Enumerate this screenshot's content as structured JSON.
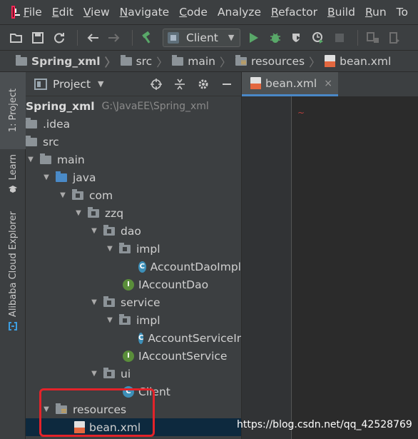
{
  "menubar": {
    "items": [
      {
        "mnemonic": "F",
        "rest": "ile"
      },
      {
        "mnemonic": "E",
        "rest": "dit"
      },
      {
        "mnemonic": "V",
        "rest": "iew"
      },
      {
        "mnemonic": "N",
        "rest": "avigate"
      },
      {
        "mnemonic": "C",
        "rest": "ode"
      },
      {
        "mnemonic": "",
        "rest": "Analyze"
      },
      {
        "mnemonic": "R",
        "rest": "efactor"
      },
      {
        "mnemonic": "B",
        "rest": "uild"
      },
      {
        "mnemonic": "R",
        "rest": "un"
      },
      {
        "mnemonic": "",
        "rest": "To"
      }
    ]
  },
  "toolbar": {
    "run_config": "Client"
  },
  "breadcrumb": {
    "items": [
      "Spring_xml",
      "src",
      "main",
      "resources",
      "bean.xml"
    ]
  },
  "side_stripe": {
    "project_tab": "1: Project",
    "learn_tab": "Learn",
    "alibaba_tab": "Alibaba Cloud Explorer"
  },
  "project_panel": {
    "title": "Project",
    "tree": [
      {
        "label": "Spring_xml",
        "hint": "G:\\JavaEE\\Spring_xml"
      },
      {
        "label": ".idea"
      },
      {
        "label": "src"
      },
      {
        "label": "main"
      },
      {
        "label": "java"
      },
      {
        "label": "com"
      },
      {
        "label": "zzq"
      },
      {
        "label": "dao"
      },
      {
        "label": "impl"
      },
      {
        "label": "AccountDaoImpl"
      },
      {
        "label": "IAccountDao"
      },
      {
        "label": "service"
      },
      {
        "label": "impl"
      },
      {
        "label": "AccountServiceIn"
      },
      {
        "label": "IAccountService"
      },
      {
        "label": "ui"
      },
      {
        "label": "Client"
      },
      {
        "label": "resources"
      },
      {
        "label": "bean.xml"
      }
    ]
  },
  "editor": {
    "tab_label": "bean.xml",
    "close_glyph": "×"
  },
  "watermark": "https://blog.csdn.net/qq_42528769",
  "colors": {
    "selection": "#0d293e",
    "highlight_box": "#e3232a",
    "run_green": "#59a869",
    "folder_blue": "#4a8ac7"
  }
}
